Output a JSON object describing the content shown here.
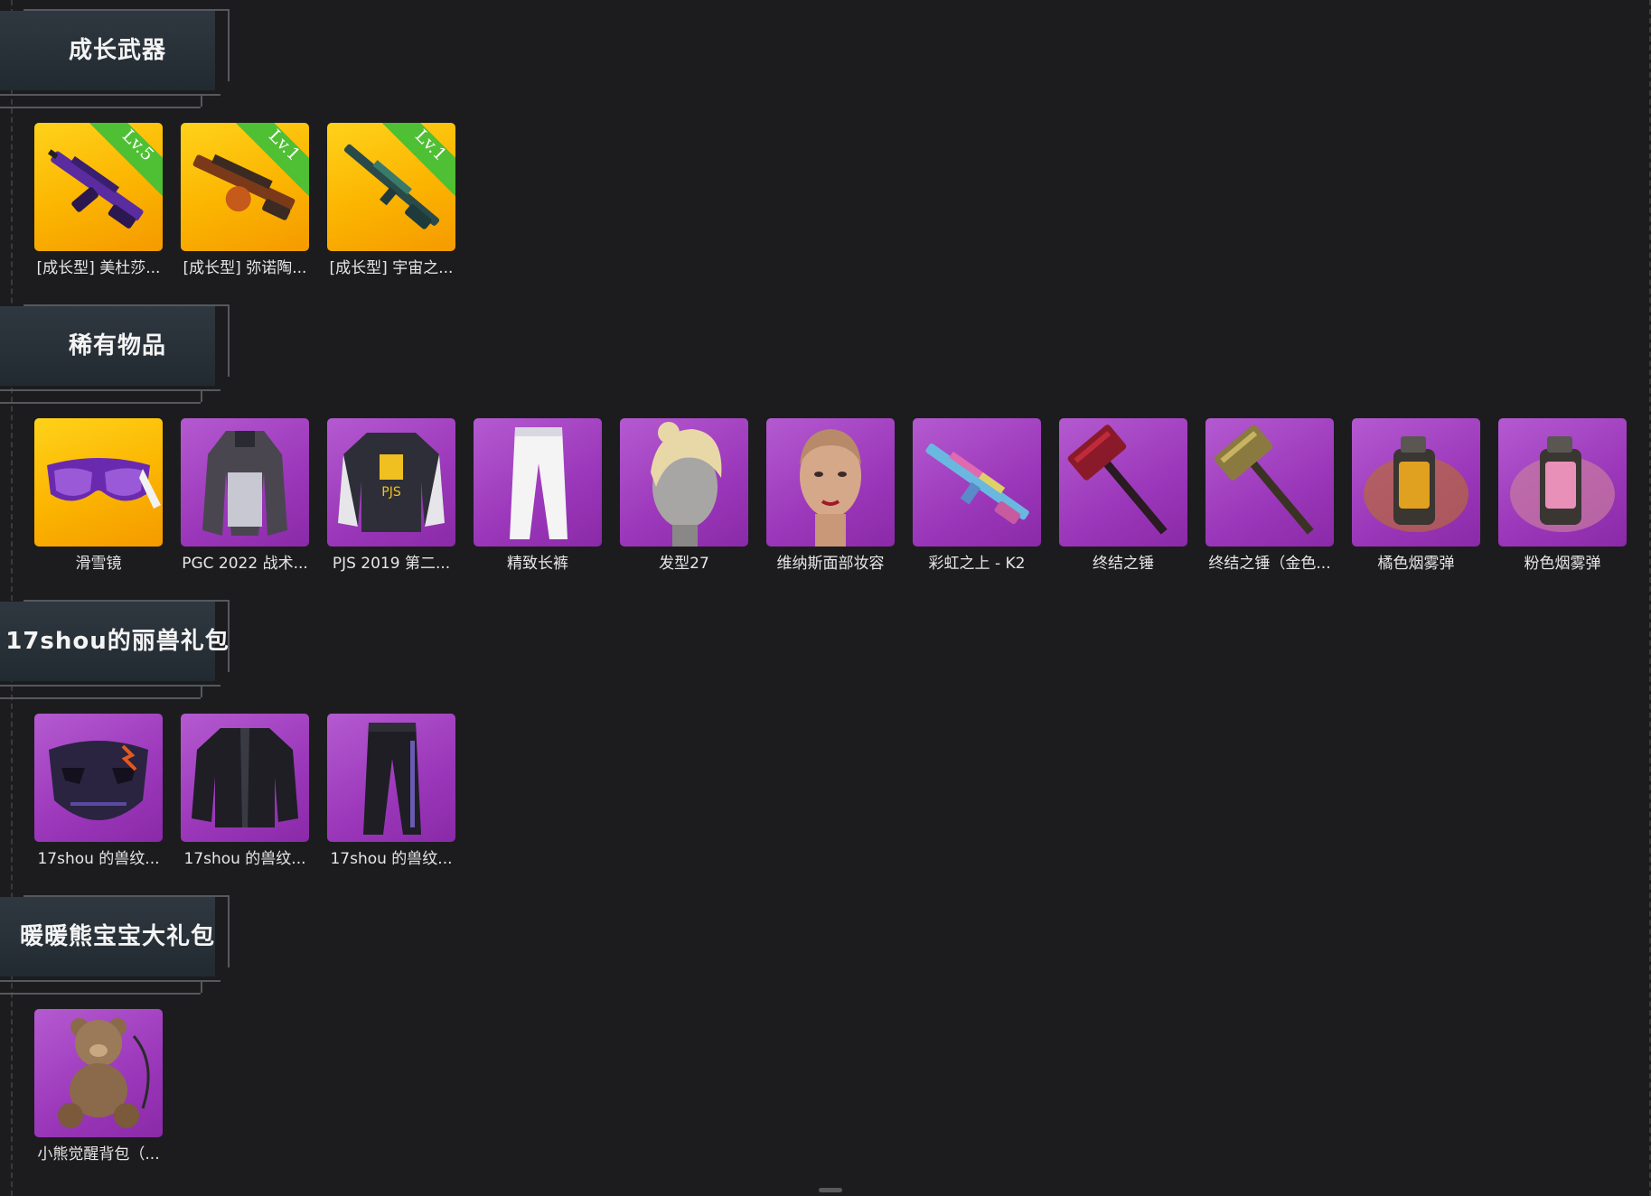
{
  "sections": [
    {
      "title": "成长武器",
      "items": [
        {
          "label": "[成长型] 美杜莎...",
          "bg": "gold",
          "level": "Lv.5",
          "icon": "rifle-icon"
        },
        {
          "label": "[成长型] 弥诺陶...",
          "bg": "gold",
          "level": "Lv.1",
          "icon": "rifle-icon"
        },
        {
          "label": "[成长型] 宇宙之...",
          "bg": "gold",
          "level": "Lv.1",
          "icon": "rifle-icon"
        }
      ]
    },
    {
      "title": "稀有物品",
      "items": [
        {
          "label": "滑雪镜",
          "bg": "gold",
          "icon": "goggles-icon"
        },
        {
          "label": "PGC 2022 战术...",
          "bg": "purple",
          "icon": "coat-icon"
        },
        {
          "label": "PJS 2019 第二...",
          "bg": "purple",
          "icon": "jacket-icon"
        },
        {
          "label": "精致长裤",
          "bg": "purple",
          "icon": "pants-icon"
        },
        {
          "label": "发型27",
          "bg": "purple",
          "icon": "hairstyle-icon"
        },
        {
          "label": "维纳斯面部妆容",
          "bg": "purple",
          "icon": "face-icon"
        },
        {
          "label": "彩虹之上 - K2",
          "bg": "purple",
          "icon": "rifle-icon"
        },
        {
          "label": "终结之锤",
          "bg": "purple",
          "icon": "hammer-icon"
        },
        {
          "label": "终结之锤（金色...",
          "bg": "purple",
          "icon": "hammer-icon"
        },
        {
          "label": "橘色烟雾弹",
          "bg": "purple",
          "icon": "grenade-icon"
        },
        {
          "label": "粉色烟雾弹",
          "bg": "purple",
          "icon": "grenade-icon"
        }
      ]
    },
    {
      "title": "17shou的丽兽礼包",
      "items": [
        {
          "label": "17shou 的兽纹...",
          "bg": "purple",
          "icon": "mask-icon"
        },
        {
          "label": "17shou 的兽纹...",
          "bg": "purple",
          "icon": "jacket-icon"
        },
        {
          "label": "17shou 的兽纹...",
          "bg": "purple",
          "icon": "pants-icon"
        }
      ]
    },
    {
      "title": "暖暖熊宝宝大礼包",
      "items": [
        {
          "label": "小熊觉醒背包（...",
          "bg": "purple",
          "icon": "teddy-bear-icon"
        }
      ]
    }
  ]
}
